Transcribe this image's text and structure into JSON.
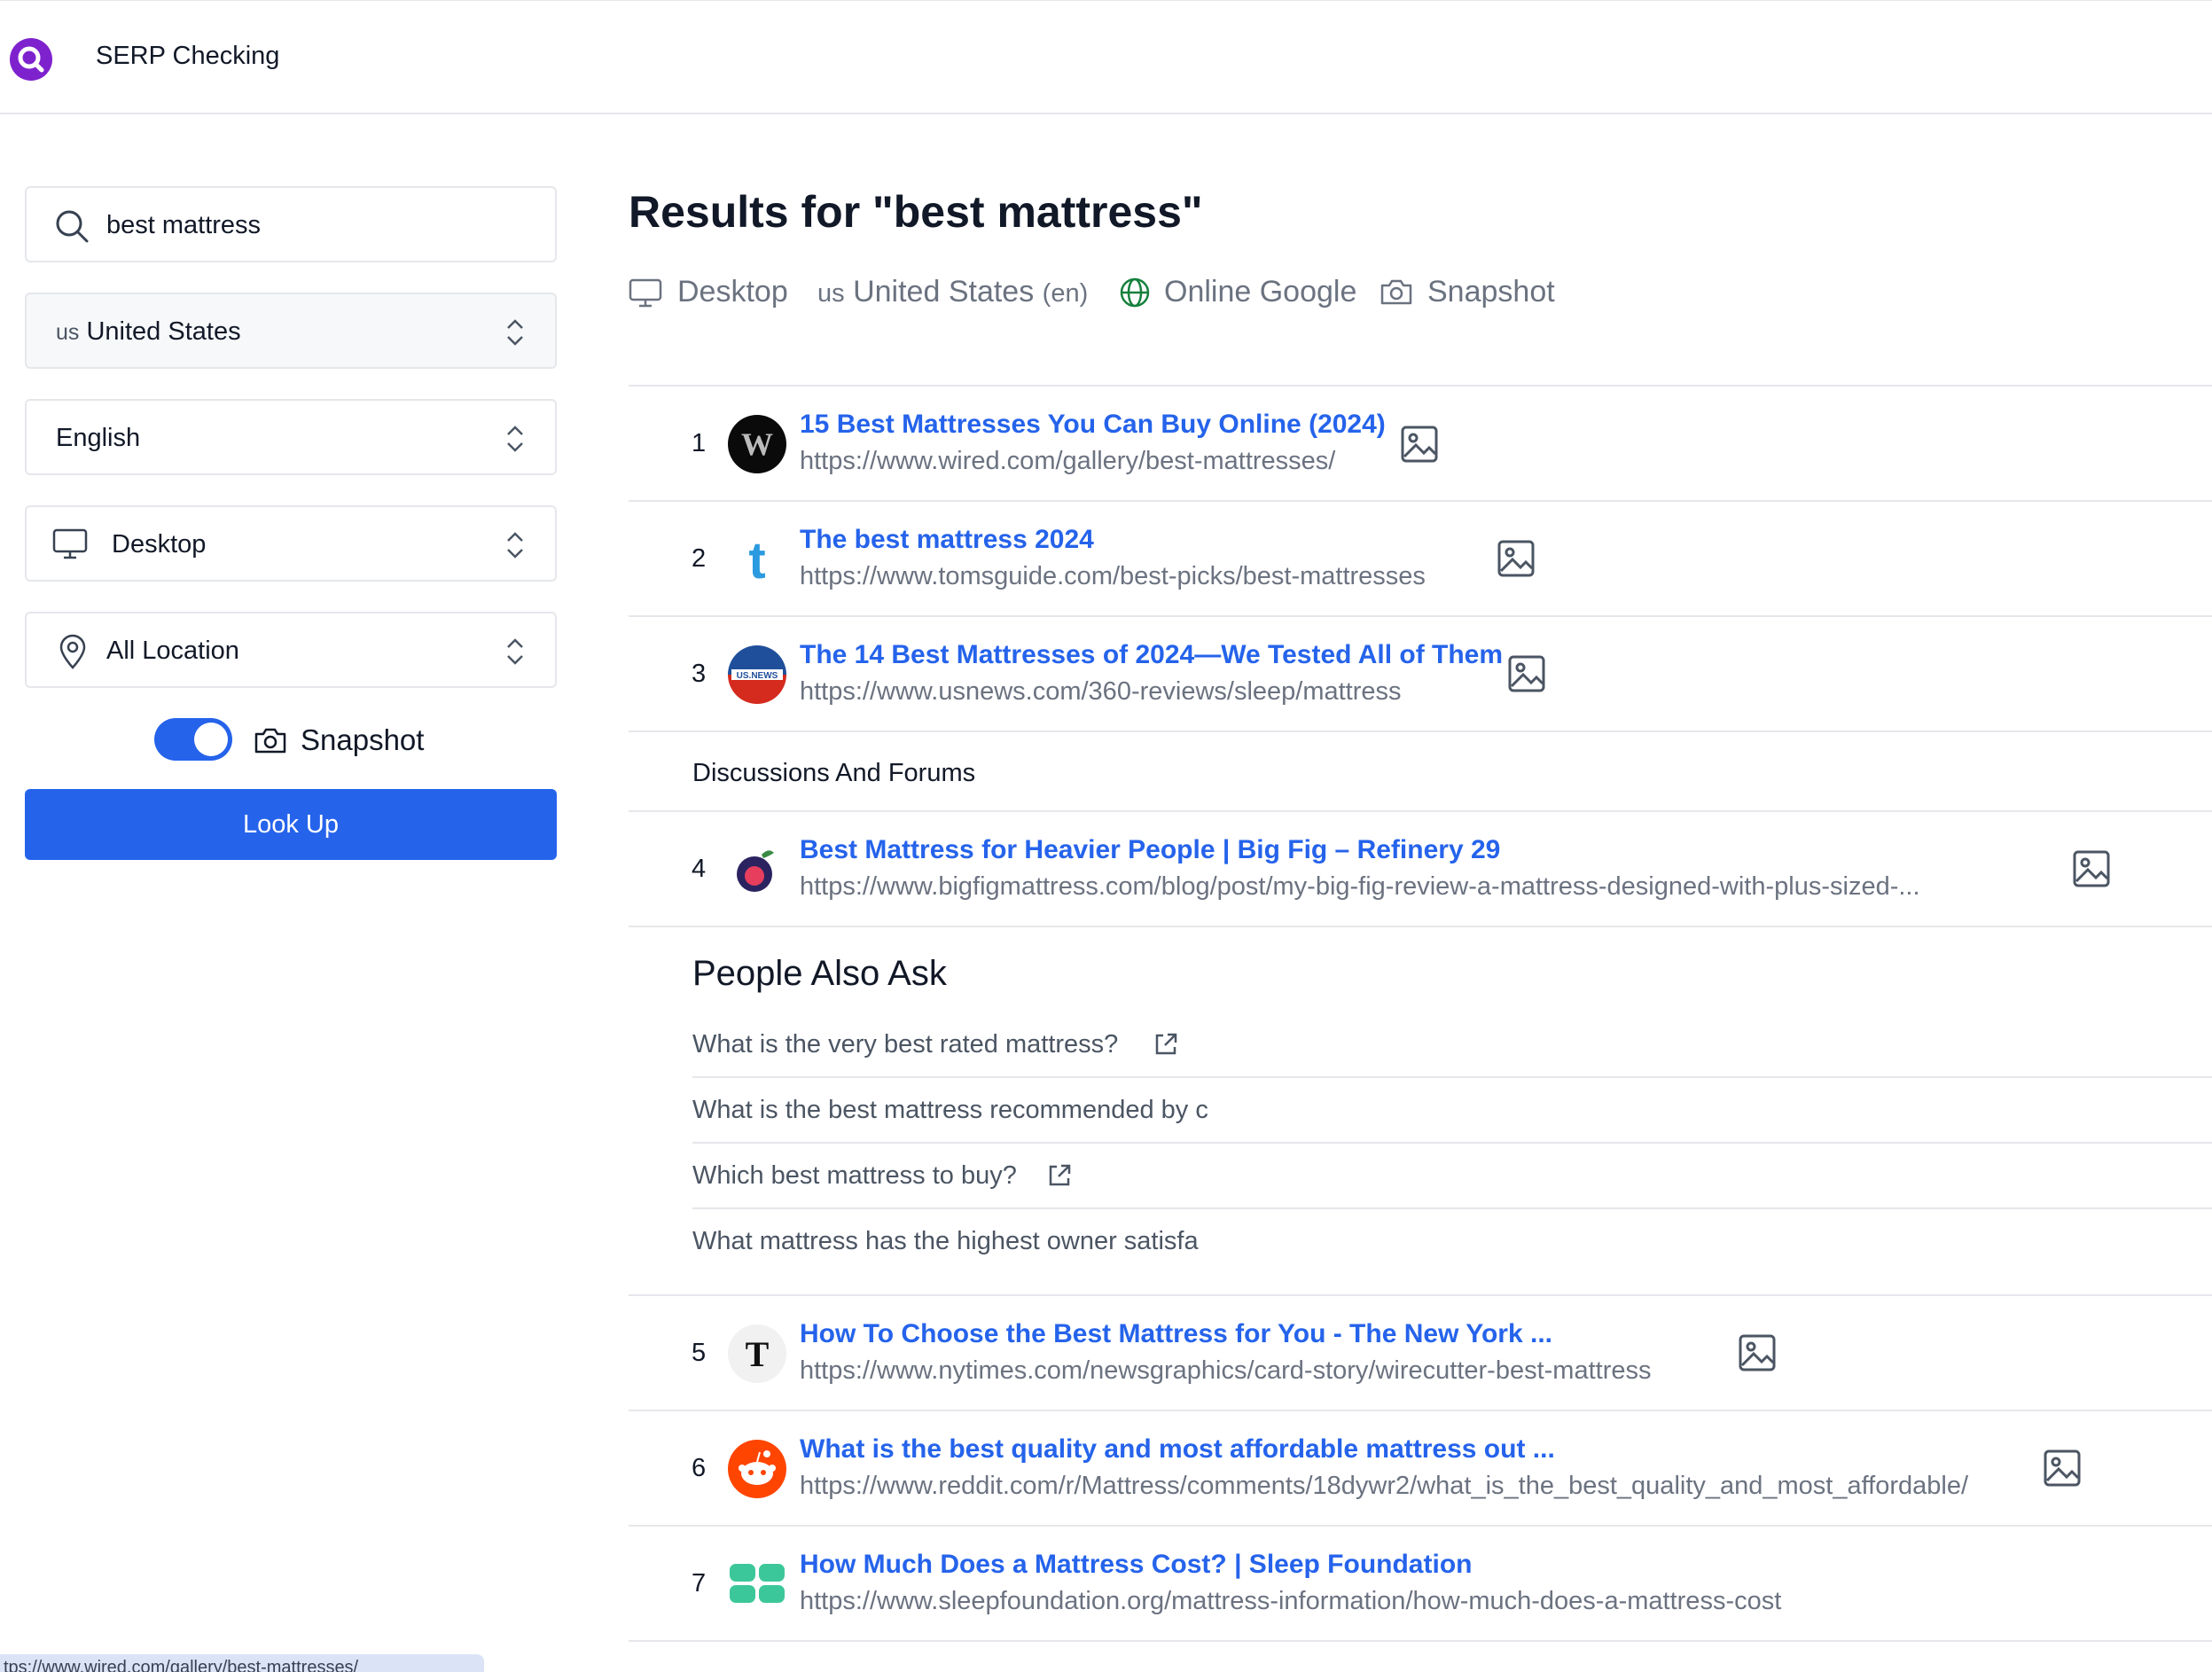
{
  "app": {
    "title": "SERP Checking"
  },
  "sidebar": {
    "search_value": "best mattress",
    "country": {
      "code": "us",
      "name": "United States"
    },
    "language": "English",
    "device": "Desktop",
    "location": "All Location",
    "snapshot_label": "Snapshot",
    "snapshot_enabled": true,
    "lookup_label": "Look Up"
  },
  "results_header": {
    "title": "Results for \"best mattress\"",
    "device": "Desktop",
    "country_code": "us",
    "country": "United States",
    "language_code": "(en)",
    "engine": "Online Google",
    "snapshot": "Snapshot"
  },
  "results": [
    {
      "rank": "1",
      "title": "15 Best Mattresses You Can Buy Online (2024)",
      "url": "https://www.wired.com/gallery/best-mattresses/",
      "favicon": "wired-icon"
    },
    {
      "rank": "2",
      "title": "The best mattress 2024",
      "url": "https://www.tomsguide.com/best-picks/best-mattresses",
      "favicon": "tomsguide-icon"
    },
    {
      "rank": "3",
      "title": "The 14 Best Mattresses of 2024—We Tested All of Them",
      "url": "https://www.usnews.com/360-reviews/sleep/mattress",
      "favicon": "usnews-icon"
    }
  ],
  "discussions": {
    "label": "Discussions And Forums",
    "items": [
      {
        "rank": "4",
        "title": "Best Mattress for Heavier People | Big Fig – Refinery 29",
        "url": "https://www.bigfigmattress.com/blog/post/my-big-fig-review-a-mattress-designed-with-plus-sized-...",
        "favicon": "bigfig-icon"
      }
    ]
  },
  "people_also_ask": {
    "title": "People Also Ask",
    "questions": [
      "What is the very best rated mattress?",
      "What is the best mattress recommended by c",
      "Which best mattress to buy?",
      "What mattress has the highest owner satisfa"
    ]
  },
  "more_results": [
    {
      "rank": "5",
      "title": "How To Choose the Best Mattress for You - The New York ...",
      "url": "https://www.nytimes.com/newsgraphics/card-story/wirecutter-best-mattress",
      "favicon": "nytimes-icon"
    },
    {
      "rank": "6",
      "title": "What is the best quality and most affordable mattress out ...",
      "url": "https://www.reddit.com/r/Mattress/comments/18dywr2/what_is_the_best_quality_and_most_affordable/",
      "favicon": "reddit-icon"
    },
    {
      "rank": "7",
      "title": "How Much Does a Mattress Cost? | Sleep Foundation",
      "url": "https://www.sleepfoundation.org/mattress-information/how-much-does-a-mattress-cost",
      "favicon": "sleepfoundation-icon"
    }
  ],
  "status_bar": {
    "hover_url": "tps://www.wired.com/gallery/best-mattresses/"
  },
  "colors": {
    "accent": "#2563eb",
    "logo": "#7e22ce",
    "link": "#2563eb",
    "muted": "#6b7280"
  }
}
